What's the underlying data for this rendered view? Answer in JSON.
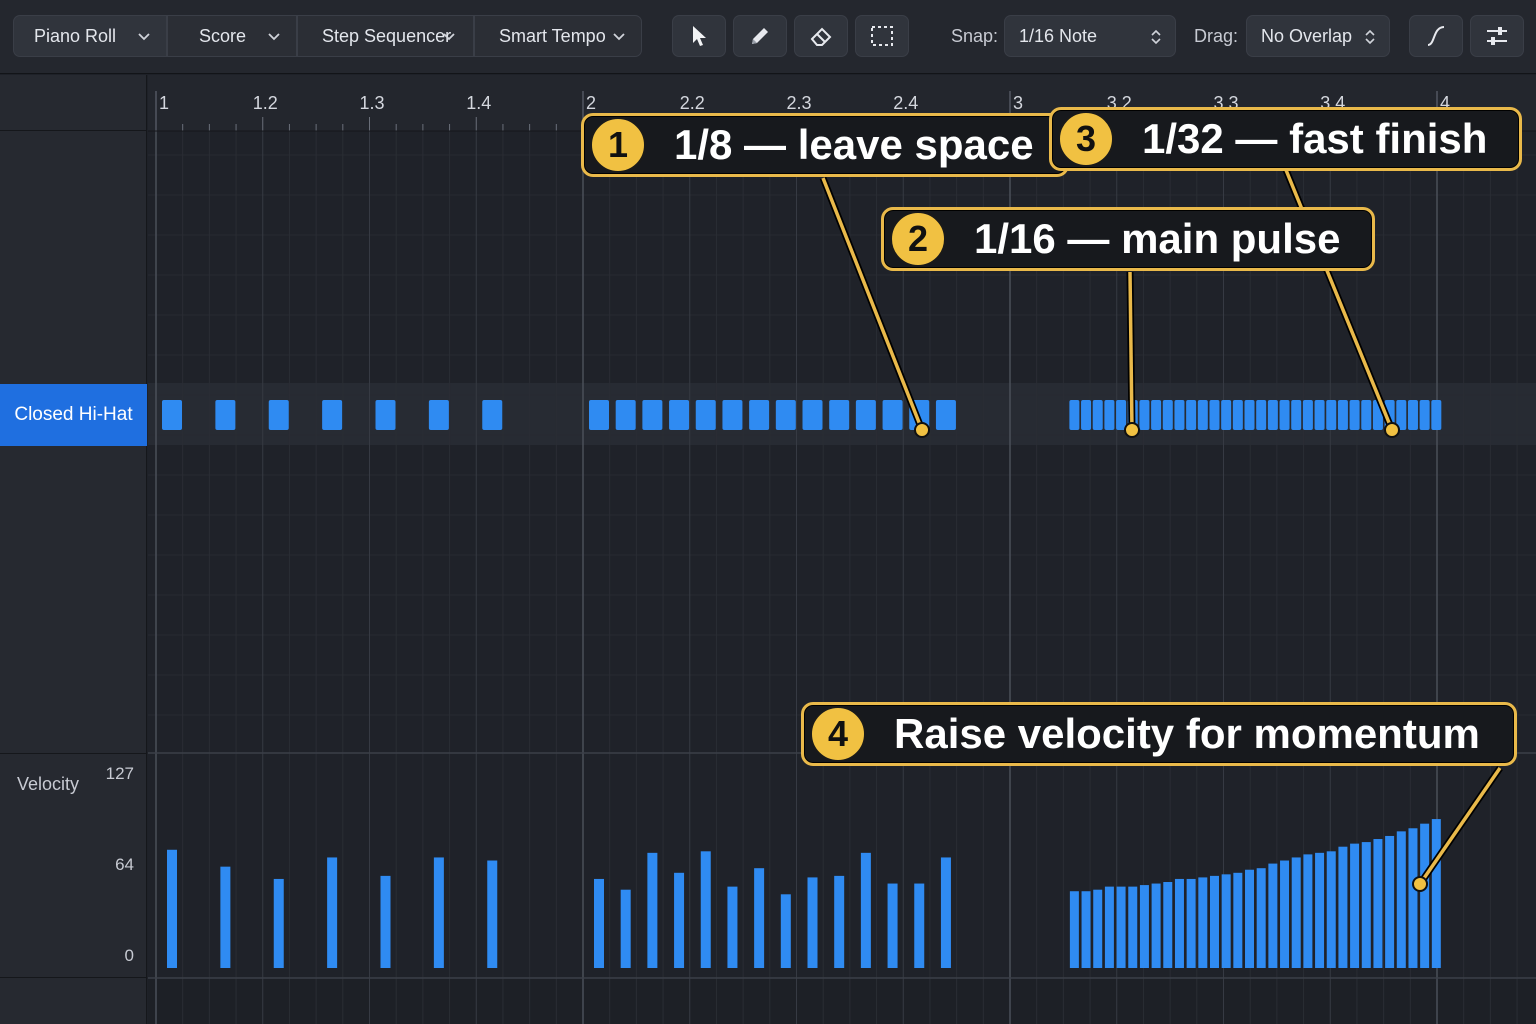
{
  "toolbar": {
    "view_tabs": [
      "Piano Roll",
      "Score",
      "Step Sequencer",
      "Smart Tempo"
    ],
    "tools": [
      "pointer-icon",
      "pencil-icon",
      "eraser-icon",
      "marquee-icon"
    ],
    "snap_label": "Snap:",
    "snap_value": "1/16 Note",
    "drag_label": "Drag:",
    "drag_value": "No Overlap",
    "right_tools": [
      "curve-icon",
      "settings-sliders-icon"
    ]
  },
  "ruler": {
    "labels": [
      "1",
      "1.2",
      "1.3",
      "1.4",
      "2",
      "2.2",
      "2.3",
      "2.4",
      "3",
      "3.2",
      "3.3",
      "3.4",
      "4"
    ]
  },
  "track": {
    "name": "Closed Hi-Hat"
  },
  "velocity_lane": {
    "label": "Velocity",
    "ticks": [
      "127",
      "64",
      "0"
    ]
  },
  "notes": {
    "bar1_eighths": [
      77,
      66,
      58,
      72,
      60,
      72,
      70
    ],
    "bar2_sixteenths": [
      58,
      51,
      75,
      62,
      76,
      53,
      65,
      48,
      59,
      60,
      75,
      55,
      55,
      72
    ],
    "bar3_thirtyseconds": [
      50,
      50,
      51,
      53,
      53,
      53,
      54,
      55,
      56,
      58,
      58,
      59,
      60,
      61,
      62,
      64,
      65,
      68,
      70,
      72,
      74,
      75,
      76,
      79,
      81,
      82,
      84,
      86,
      89,
      91,
      94,
      97
    ]
  },
  "callouts": [
    {
      "num": "1",
      "text": "1/8 — leave space"
    },
    {
      "num": "2",
      "text": "1/16 — main pulse"
    },
    {
      "num": "3",
      "text": "1/32 — fast finish"
    },
    {
      "num": "4",
      "text": "Raise velocity for momentum"
    }
  ],
  "colors": {
    "accent": "#1f6fe0",
    "note": "#2f8bf2",
    "callout_border": "#e9b94a",
    "callout_badge": "#f1c142"
  }
}
